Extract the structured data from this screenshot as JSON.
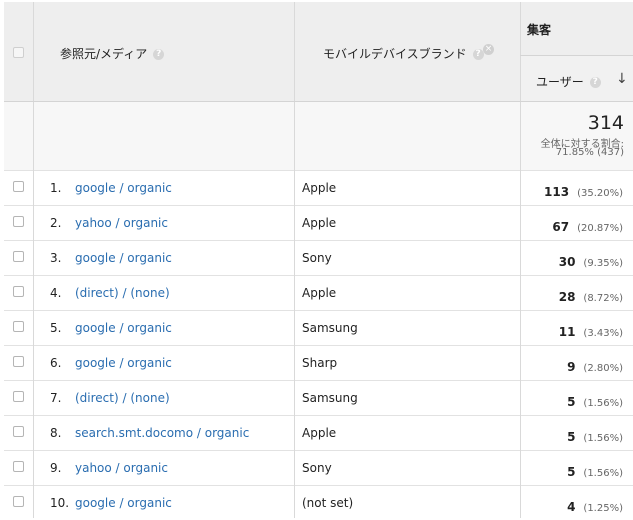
{
  "header": {
    "source_medium": "参照元/メディア",
    "device_brand": "モバイルデバイスブランド",
    "acquisition_group": "集客",
    "users": "ユーザー",
    "help_glyph": "?",
    "remove_glyph": "×",
    "sort_glyph": "↓"
  },
  "totals": {
    "value": "314",
    "label": "全体に対する割合:",
    "share": "71.85% (437)"
  },
  "rows": [
    {
      "index": "1.",
      "source": "google / organic",
      "brand": "Apple",
      "users": "113",
      "pct": "(35.20%)"
    },
    {
      "index": "2.",
      "source": "yahoo / organic",
      "brand": "Apple",
      "users": "67",
      "pct": "(20.87%)"
    },
    {
      "index": "3.",
      "source": "google / organic",
      "brand": "Sony",
      "users": "30",
      "pct": "(9.35%)"
    },
    {
      "index": "4.",
      "source": "(direct) / (none)",
      "brand": "Apple",
      "users": "28",
      "pct": "(8.72%)"
    },
    {
      "index": "5.",
      "source": "google / organic",
      "brand": "Samsung",
      "users": "11",
      "pct": "(3.43%)"
    },
    {
      "index": "6.",
      "source": "google / organic",
      "brand": "Sharp",
      "users": "9",
      "pct": "(2.80%)"
    },
    {
      "index": "7.",
      "source": "(direct) / (none)",
      "brand": "Samsung",
      "users": "5",
      "pct": "(1.56%)"
    },
    {
      "index": "8.",
      "source": "search.smt.docomo / organic",
      "brand": "Apple",
      "users": "5",
      "pct": "(1.56%)"
    },
    {
      "index": "9.",
      "source": "yahoo / organic",
      "brand": "Sony",
      "users": "5",
      "pct": "(1.56%)"
    },
    {
      "index": "10.",
      "source": "google / organic",
      "brand": "(not set)",
      "users": "4",
      "pct": "(1.25%)"
    }
  ]
}
